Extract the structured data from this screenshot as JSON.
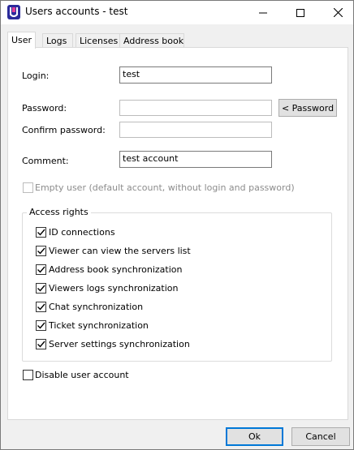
{
  "window": {
    "title": "Users accounts - test"
  },
  "tabs": [
    "User",
    "Logs",
    "Licenses",
    "Address book"
  ],
  "form": {
    "login_label": "Login:",
    "login_value": "test",
    "password_label": "Password:",
    "password_value": "",
    "password_button": "< Password",
    "confirm_label": "Confirm password:",
    "confirm_value": "",
    "comment_label": "Comment:",
    "comment_value": "test account",
    "empty_user_label": "Empty user (default account, without login and password)",
    "empty_user_checked": false
  },
  "access_rights": {
    "title": "Access rights",
    "items": [
      {
        "label": "ID connections",
        "checked": true
      },
      {
        "label": "Viewer can view the servers list",
        "checked": true
      },
      {
        "label": "Address book synchronization",
        "checked": true
      },
      {
        "label": "Viewers logs synchronization",
        "checked": true
      },
      {
        "label": "Chat synchronization",
        "checked": true
      },
      {
        "label": "Ticket synchronization",
        "checked": true
      },
      {
        "label": "Server settings synchronization",
        "checked": true
      }
    ]
  },
  "disable_account": {
    "label": "Disable user account",
    "checked": false
  },
  "buttons": {
    "ok": "Ok",
    "cancel": "Cancel"
  },
  "colors": {
    "accent": "#0078d7",
    "icon_bg": "#2b2b9b"
  }
}
